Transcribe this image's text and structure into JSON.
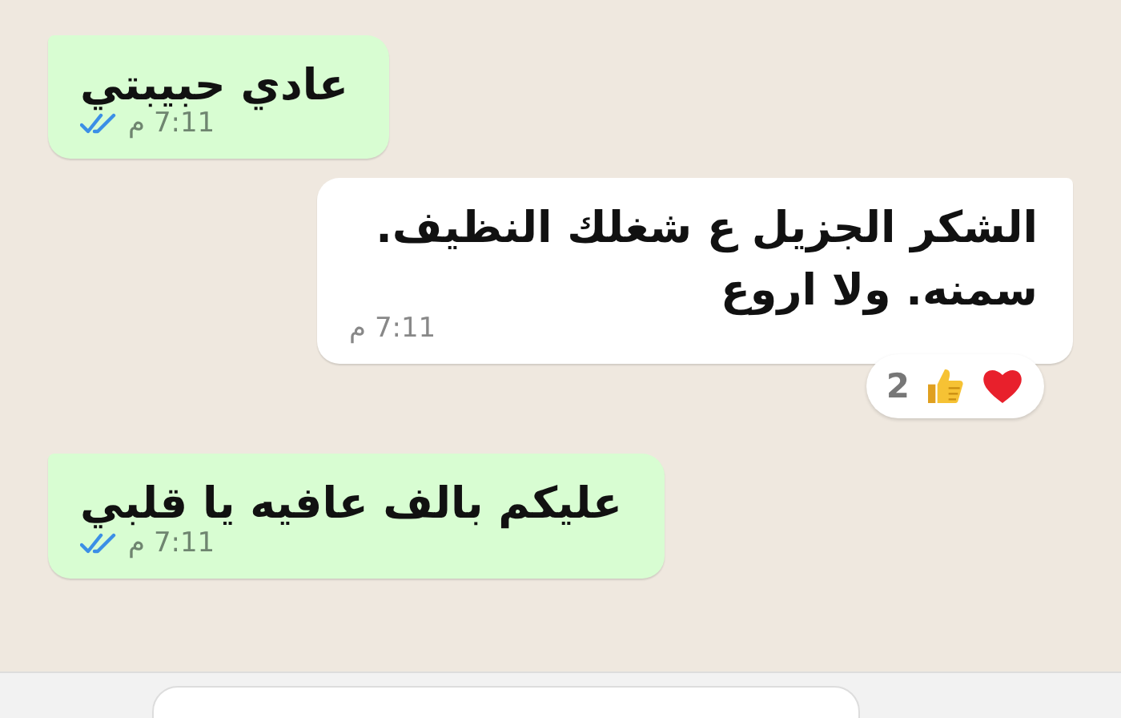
{
  "messages": [
    {
      "kind": "outgoing",
      "text": "عادي حبيبتي",
      "time": "7:11 م",
      "read": true
    },
    {
      "kind": "incoming",
      "text": "الشكر الجزيل ع شغلك النظيف. سمنه. ولا اروع",
      "time": "7:11 م",
      "reactions": [
        {
          "kind": "heart"
        },
        {
          "kind": "thumbs-up"
        }
      ],
      "reaction_count": "2"
    },
    {
      "kind": "outgoing",
      "text": "عليكم بالف عافيه يا قلبي",
      "time": "7:11 م",
      "read": true
    }
  ]
}
